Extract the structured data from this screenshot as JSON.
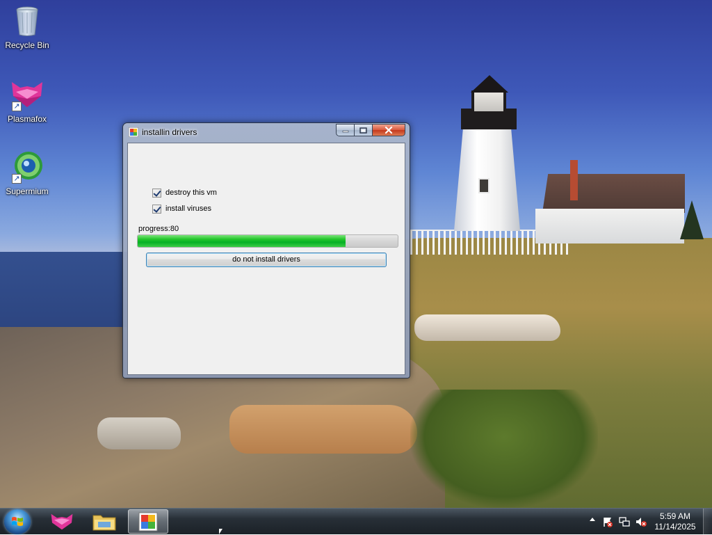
{
  "desktop": {
    "icons": [
      {
        "label": "Recycle Bin",
        "icon": "recycle-bin-icon"
      },
      {
        "label": "Plasmafox",
        "icon": "plasmafox-icon"
      },
      {
        "label": "Supermium",
        "icon": "supermium-icon"
      }
    ]
  },
  "dialog": {
    "title": "installin drivers",
    "icon": "winforms-app-icon",
    "checkboxes": [
      {
        "label": "destroy this vm",
        "checked": true
      },
      {
        "label": "install viruses",
        "checked": true
      }
    ],
    "progress_label": "progress:80",
    "progress_value": 80,
    "progress_max": 100,
    "button_label": "do not install drivers",
    "caption_buttons": {
      "minimize": "minimize-icon",
      "maximize": "maximize-icon",
      "close": "close-icon"
    }
  },
  "taskbar": {
    "pinned": [
      {
        "name": "plasmafox-taskbar",
        "icon": "plasmafox-icon"
      },
      {
        "name": "explorer-taskbar",
        "icon": "folder-icon"
      },
      {
        "name": "app-taskbar",
        "icon": "winforms-app-icon",
        "active": true
      }
    ],
    "clock": {
      "time": "5:59 AM",
      "date": "11/14/2025"
    },
    "tray_icons": [
      "action-center-flag-icon",
      "network-icon",
      "volume-muted-icon"
    ]
  },
  "colors": {
    "progress_green": "#06b025",
    "close_red": "#c2371b",
    "button_focus_border": "#3c7fb1"
  }
}
